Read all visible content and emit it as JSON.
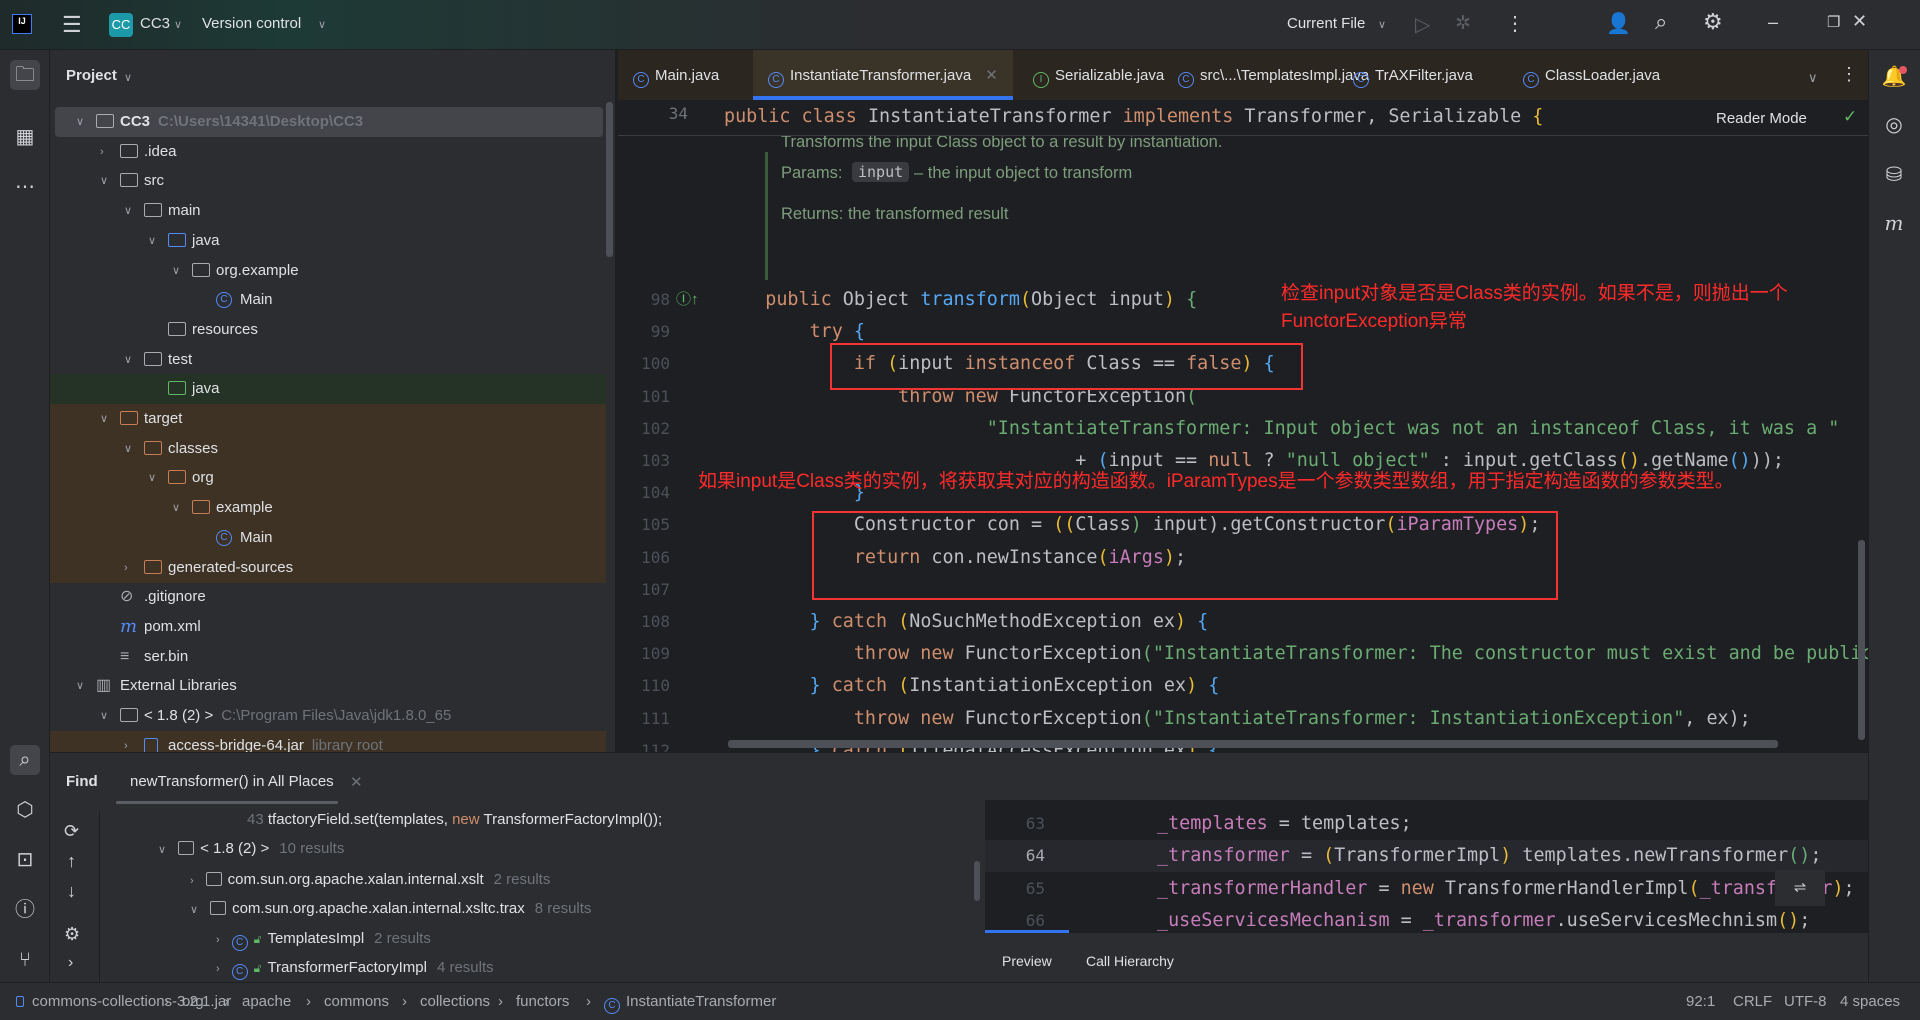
{
  "titlebar": {
    "logo": "IJ",
    "project_badge": "CC",
    "project": "CC3",
    "vcs": "Version control",
    "run_config": "Current File"
  },
  "project": {
    "title": "Project",
    "rows": [
      {
        "label": "CC3",
        "sub": "C:\\Users\\14341\\Desktop\\CC3",
        "lvl": 0,
        "chev": "down",
        "icon": "module",
        "bg": "sel"
      },
      {
        "label": ".idea",
        "lvl": 1,
        "chev": "right",
        "icon": "folder"
      },
      {
        "label": "src",
        "lvl": 1,
        "chev": "down",
        "icon": "folder"
      },
      {
        "label": "main",
        "lvl": 2,
        "chev": "down",
        "icon": "folder"
      },
      {
        "label": "java",
        "lvl": 3,
        "chev": "down",
        "icon": "src-folder"
      },
      {
        "label": "org.example",
        "lvl": 4,
        "chev": "down",
        "icon": "package"
      },
      {
        "label": "Main",
        "lvl": 5,
        "chev": "",
        "icon": "class"
      },
      {
        "label": "resources",
        "lvl": 3,
        "chev": "",
        "icon": "resources"
      },
      {
        "label": "test",
        "lvl": 2,
        "chev": "down",
        "icon": "folder"
      },
      {
        "label": "java",
        "lvl": 3,
        "chev": "",
        "icon": "test-folder",
        "bg": "green"
      },
      {
        "label": "target",
        "lvl": 1,
        "chev": "down",
        "icon": "excluded",
        "bg": "orange"
      },
      {
        "label": "classes",
        "lvl": 2,
        "chev": "down",
        "icon": "excluded",
        "bg": "orange"
      },
      {
        "label": "org",
        "lvl": 3,
        "chev": "down",
        "icon": "excluded",
        "bg": "orange"
      },
      {
        "label": "example",
        "lvl": 4,
        "chev": "down",
        "icon": "excluded",
        "bg": "orange"
      },
      {
        "label": "Main",
        "lvl": 5,
        "chev": "",
        "icon": "class",
        "bg": "orange"
      },
      {
        "label": "generated-sources",
        "lvl": 2,
        "chev": "right",
        "icon": "excluded",
        "bg": "orange"
      },
      {
        "label": ".gitignore",
        "lvl": 1,
        "chev": "",
        "icon": "ignore"
      },
      {
        "label": "pom.xml",
        "lvl": 1,
        "chev": "",
        "icon": "maven"
      },
      {
        "label": "ser.bin",
        "lvl": 1,
        "chev": "",
        "icon": "text"
      },
      {
        "label": "External Libraries",
        "lvl": 0,
        "chev": "down",
        "icon": "library"
      },
      {
        "label": "< 1.8 (2) >",
        "sub": "C:\\Program Files\\Java\\jdk1.8.0_65",
        "lvl": 1,
        "chev": "down",
        "icon": "jdk"
      },
      {
        "label": "access-bridge-64.jar",
        "sub": "library root",
        "lvl": 2,
        "chev": "right",
        "icon": "jar",
        "bg": "orange"
      }
    ]
  },
  "tabs": [
    {
      "label": "Main.java",
      "icon": "class-icon"
    },
    {
      "label": "InstantiateTransformer.java",
      "icon": "class-icon",
      "active": true
    },
    {
      "label": "Serializable.java",
      "icon": "interface-icon"
    },
    {
      "label": "src\\...\\TemplatesImpl.java",
      "icon": "class-icon"
    },
    {
      "label": "TrAXFilter.java",
      "icon": "class-icon"
    },
    {
      "label": "ClassLoader.java",
      "icon": "class-icon"
    }
  ],
  "editor": {
    "reader_mode": "Reader Mode",
    "sticky": {
      "num": "34",
      "tokens": [
        [
          "public class ",
          "k"
        ],
        [
          "InstantiateTransformer ",
          "d"
        ],
        [
          "implements ",
          "k"
        ],
        [
          "Transformer, Serializable ",
          "d"
        ],
        [
          "{",
          "y"
        ]
      ]
    },
    "doc": {
      "summary": "Transforms the input Class object to a result by instantiation.",
      "params_label": "Params:",
      "param": "input",
      "param_desc": "– the input object to transform",
      "returns": "Returns: the transformed result"
    },
    "lines": [
      {
        "num": "98",
        "tokens": [
          [
            "    public ",
            "k"
          ],
          [
            "Object ",
            "d"
          ],
          [
            "transform",
            "m"
          ],
          [
            "(",
            "y"
          ],
          [
            "Object input",
            "d"
          ],
          [
            ")",
            "y"
          ],
          [
            " {",
            "g"
          ]
        ]
      },
      {
        "num": "99",
        "tokens": [
          [
            "        try ",
            "k"
          ],
          [
            "{",
            "b"
          ]
        ]
      },
      {
        "num": "100",
        "tokens": [
          [
            "            if ",
            "k"
          ],
          [
            "(",
            "y"
          ],
          [
            "input ",
            "d"
          ],
          [
            "instanceof ",
            "k"
          ],
          [
            "Class == ",
            "d"
          ],
          [
            "false",
            "k"
          ],
          [
            ")",
            "y"
          ],
          [
            " {",
            "b"
          ]
        ]
      },
      {
        "num": "101",
        "tokens": [
          [
            "                throw new ",
            "k"
          ],
          [
            "FunctorException",
            "d"
          ],
          [
            "(",
            "g"
          ]
        ]
      },
      {
        "num": "102",
        "tokens": [
          [
            "                        \"InstantiateTransformer: Input object was not an instanceof Class, it was a \"",
            "s"
          ]
        ]
      },
      {
        "num": "103",
        "tokens": [
          [
            "                                + ",
            "d"
          ],
          [
            "(",
            "b"
          ],
          [
            "input == ",
            "d"
          ],
          [
            "null",
            "k"
          ],
          [
            " ? ",
            "d"
          ],
          [
            "\"null object\"",
            "s"
          ],
          [
            " : input.getClass",
            "d"
          ],
          [
            "()",
            "y"
          ],
          [
            ".getName",
            "d"
          ],
          [
            "()",
            "b"
          ],
          [
            "));",
            "d"
          ]
        ]
      },
      {
        "num": "104",
        "tokens": [
          [
            "            }",
            "b"
          ]
        ]
      },
      {
        "num": "105",
        "tokens": [
          [
            "            Constructor con = ",
            "d"
          ],
          [
            "((",
            "y"
          ],
          [
            "Class",
            "d"
          ],
          [
            ")",
            "g"
          ],
          [
            " input",
            ""
          ],
          [
            ").getConstructor",
            "d"
          ],
          [
            "(",
            "y"
          ],
          [
            "iParamTypes",
            "f"
          ],
          [
            ")",
            "y"
          ],
          [
            ";",
            "d"
          ]
        ]
      },
      {
        "num": "106",
        "tokens": [
          [
            "            return ",
            "k"
          ],
          [
            "con.newInstance",
            "d"
          ],
          [
            "(",
            "y"
          ],
          [
            "iArgs",
            "f"
          ],
          [
            ")",
            "y"
          ],
          [
            ";",
            "d"
          ]
        ]
      },
      {
        "num": "107",
        "tokens": []
      },
      {
        "num": "108",
        "tokens": [
          [
            "        } ",
            "b"
          ],
          [
            "catch ",
            "k"
          ],
          [
            "(",
            "y"
          ],
          [
            "NoSuchMethodException ex",
            "d"
          ],
          [
            ")",
            "y"
          ],
          [
            " {",
            "b"
          ]
        ]
      },
      {
        "num": "109",
        "tokens": [
          [
            "            throw new ",
            "k"
          ],
          [
            "FunctorException",
            "d"
          ],
          [
            "(",
            "g"
          ],
          [
            "\"InstantiateTransformer: The constructor must exist and be public \"",
            "s"
          ]
        ]
      },
      {
        "num": "110",
        "tokens": [
          [
            "        } ",
            "b"
          ],
          [
            "catch ",
            "k"
          ],
          [
            "(",
            "y"
          ],
          [
            "InstantiationException ex",
            "d"
          ],
          [
            ")",
            "y"
          ],
          [
            " {",
            "b"
          ]
        ]
      },
      {
        "num": "111",
        "tokens": [
          [
            "            throw new ",
            "k"
          ],
          [
            "FunctorException",
            "d"
          ],
          [
            "(",
            "g"
          ],
          [
            "\"InstantiateTransformer: InstantiationException\"",
            "s"
          ],
          [
            ", ex);",
            "d"
          ]
        ]
      },
      {
        "num": "112",
        "tokens": [
          [
            "        } ",
            "b"
          ],
          [
            "catch ",
            "k"
          ],
          [
            "(",
            "y"
          ],
          [
            "IllegalAccessException ex",
            "d"
          ],
          [
            ")",
            "y"
          ],
          [
            " {",
            "b"
          ]
        ]
      }
    ],
    "annotation1_line1": "检查input对象是否是Class类的实例。如果不是，则抛出一个",
    "annotation1_line2": "FunctorException异常",
    "annotation2": "如果input是Class类的实例，将获取其对应的构造函数。iParamTypes是一个参数类型数组，用于指定构造函数的参数类型。"
  },
  "find": {
    "title": "Find",
    "tab": "newTransformer() in All Places",
    "rows": [
      {
        "pre": "43 ",
        "text": "tfactoryField.set(templates, ",
        "kw": "new",
        "post": " TransformerFactoryImpl());"
      },
      {
        "label": "< 1.8 (2) >",
        "count": "10 results"
      },
      {
        "label": "com.sun.org.apache.xalan.internal.xslt",
        "count": "2 results"
      },
      {
        "label": "com.sun.org.apache.xalan.internal.xsltc.trax",
        "count": "8 results"
      },
      {
        "label": "TemplatesImpl",
        "count": "2 results"
      },
      {
        "label": "TransformerFactoryImpl",
        "count": "4 results"
      }
    ],
    "preview_lines": [
      {
        "num": "63",
        "tokens": [
          [
            "_templates",
            "f"
          ],
          [
            " = templates;",
            "d"
          ]
        ]
      },
      {
        "num": "64",
        "tokens": [
          [
            "_transformer",
            "f"
          ],
          [
            " = ",
            "d"
          ],
          [
            "(",
            "y"
          ],
          [
            "TransformerImpl",
            "d"
          ],
          [
            ")",
            "y"
          ],
          [
            " templates.newTransformer",
            "d"
          ],
          [
            "()",
            "g"
          ],
          [
            ";",
            "d"
          ]
        ]
      },
      {
        "num": "65",
        "tokens": [
          [
            "_transformerHandler",
            "f"
          ],
          [
            " = ",
            "d"
          ],
          [
            "new ",
            "k"
          ],
          [
            "TransformerHandlerImpl",
            "d"
          ],
          [
            "(",
            "y"
          ],
          [
            "_transformer",
            "f"
          ],
          [
            ")",
            "y"
          ],
          [
            ";",
            "d"
          ]
        ]
      },
      {
        "num": "66",
        "tokens": [
          [
            "_useServicesMechanism",
            "f"
          ],
          [
            " = ",
            "d"
          ],
          [
            "_transformer",
            "f"
          ],
          [
            ".useServicesMechnism",
            "d"
          ],
          [
            "()",
            "y"
          ],
          [
            ";",
            "d"
          ]
        ]
      }
    ],
    "preview_tab": "Preview",
    "call_hierarchy_tab": "Call Hierarchy"
  },
  "status": {
    "crumbs": [
      "commons-collections-3.2.1.jar",
      "org",
      "apache",
      "commons",
      "collections",
      "functors",
      "InstantiateTransformer"
    ],
    "position": "92:1",
    "line_sep": "CRLF",
    "encoding": "UTF-8",
    "indent": "4 spaces"
  },
  "colors": {
    "annotation": "#ff2a2a",
    "accent": "#3574f0"
  }
}
